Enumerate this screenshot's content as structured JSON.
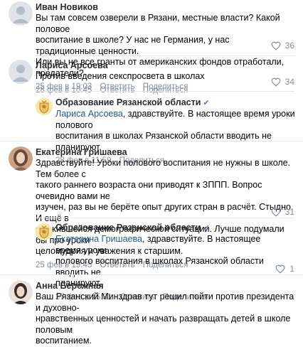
{
  "comments": [
    {
      "author": "Иван Новиков",
      "lines": [
        "Вы там совсем озверели в Рязани, местные власти? Какой половое",
        "воспитание в школе? У нас не Германия, у нас традиционные ценности.",
        "Или вы не все гранты от американских фондов отработали, предатели?"
      ],
      "date": "25 фев в 19:03",
      "reply_label": "Ответить",
      "share_label": "Поделиться",
      "likes": "36"
    },
    {
      "author": "Лариса Арсоева",
      "lines": [
        "Против введения секспросвета в школах"
      ],
      "date": "28 фев в 10:45",
      "reply_label": "Ответить",
      "share_label": "Поделиться",
      "likes": "34"
    },
    {
      "author": "Образование Рязанской области",
      "reply_to": "Лариса Арсоева",
      "lines": [
        ", здравствуйте. В настоящее время уроки полового",
        "воспитания в школах Рязанской области вводить не планируют."
      ],
      "date": "28 фев в 11:59",
      "share_label": "Поделиться"
    },
    {
      "author": "Екатерина Гришаева",
      "lines": [
        "Здравствуйте! Уроки полового воспитания не нужны в школе. Тем более с",
        "такого раннего возраста они приводят к ЗППП. Вопрос очевидно вами не",
        "изучен, раз вы не берёте опыт других стран в расчёт. Стыдно. И ещё в",
        "сложившейся демографической ситуации. Лучше подумали бы про уроки",
        "целомудрия и уважения к старшим."
      ],
      "date": "25 фев в 19:45",
      "reply_label": "Ответить",
      "share_label": "Поделиться",
      "likes": "31"
    },
    {
      "author": "Образование Рязанской области",
      "reply_to": "Екатерина Гришаева",
      "lines": [
        ", здравствуйте. В настоящее время уроки",
        "полового воспитания в школах Рязанской области вводить не",
        "планируют."
      ],
      "date": "27 фев в 15:31",
      "reply_label": "Ответить",
      "share_label": "Поделиться",
      "likes": "1"
    },
    {
      "author": "Анна Бережная",
      "lines": [
        "Ваш Рязанский Минздрав тут решил пойти против президента и духовно-",
        "нравственных ценностей и начать развращать детей в школе половым",
        "воспитанием."
      ]
    }
  ],
  "colors": {
    "link": "#2a5885",
    "meta": "#818c99",
    "divider": "#e7e8ec",
    "org_avatar_bg": "#f6e7a8",
    "org_avatar_fg": "#b8872a"
  },
  "icons": {
    "like": "heart-icon",
    "verified": "check-icon",
    "crest": "coat-of-arms-icon"
  }
}
